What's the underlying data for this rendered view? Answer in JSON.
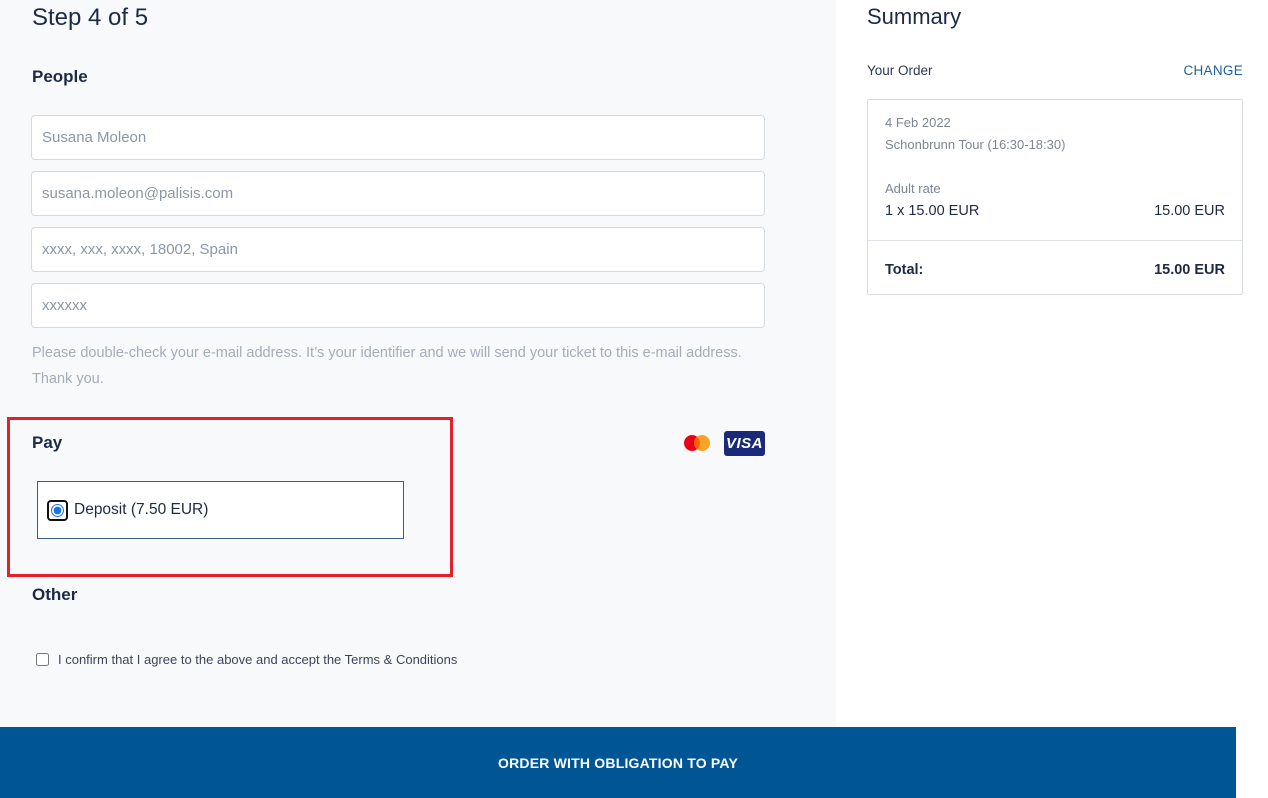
{
  "step": {
    "title": "Step 4 of 5"
  },
  "people": {
    "heading": "People",
    "fields": [
      {
        "name": "name",
        "placeholder": "Susana Moleon"
      },
      {
        "name": "email",
        "placeholder": "susana.moleon@palisis.com"
      },
      {
        "name": "address",
        "placeholder": "xxxx, xxx, xxxx, 18002, Spain"
      },
      {
        "name": "phone",
        "placeholder": "xxxxxx"
      }
    ],
    "hint": "Please double-check your e-mail address. It’s your identifier and we will send your ticket to this e-mail address. Thank you."
  },
  "pay": {
    "heading": "Pay",
    "option_label": "Deposit (7.50 EUR)",
    "card_brands": [
      "mastercard-icon",
      "visa-icon"
    ],
    "visa_text": "VISA"
  },
  "other": {
    "heading": "Other",
    "confirm_label": "I confirm that I agree to the above and accept the Terms & Conditions"
  },
  "summary": {
    "title": "Summary",
    "your_order": "Your Order",
    "change": "CHANGE",
    "date": "4 Feb 2022",
    "tour": "Schonbrunn Tour (16:30-18:30)",
    "rate_label": "Adult rate",
    "quantity_line": "1 x 15.00 EUR",
    "line_price": "15.00 EUR",
    "total_label": "Total:",
    "total_value": "15.00 EUR"
  },
  "footer": {
    "order_button": "ORDER WITH OBLIGATION TO PAY"
  },
  "colors": {
    "primary": "#005695",
    "highlight": "#e3202b",
    "link": "#1e5f9e"
  }
}
